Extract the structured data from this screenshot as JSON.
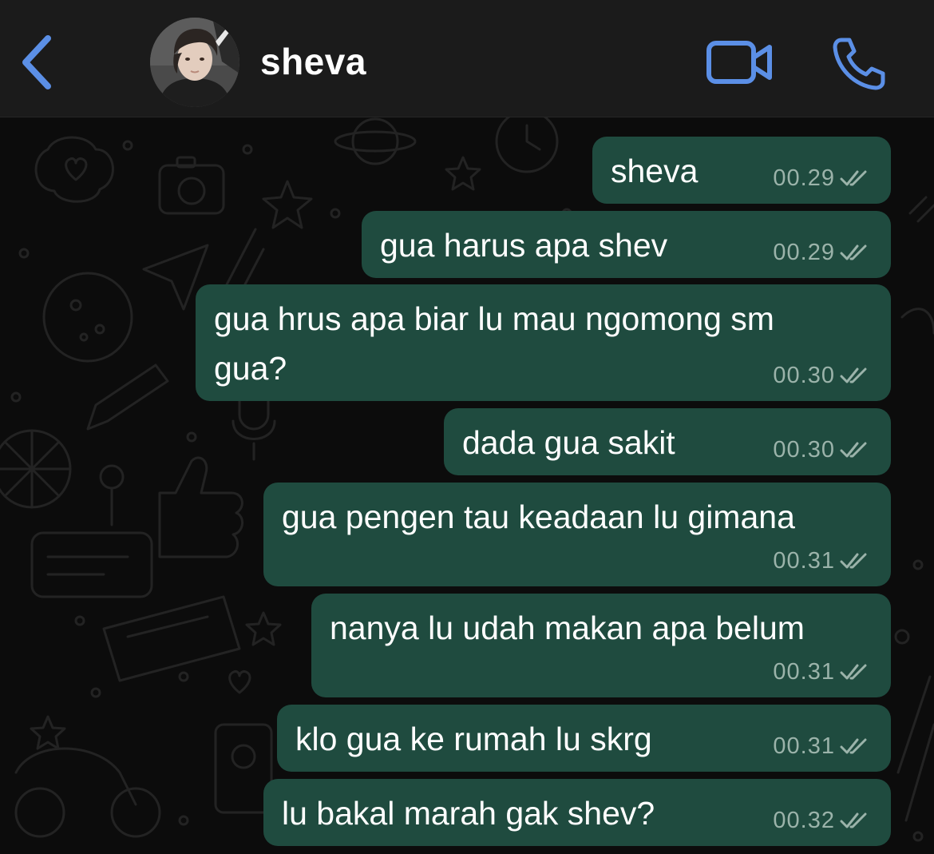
{
  "header": {
    "contact_name": "sheva",
    "back_icon": "chevron-left-icon",
    "video_icon": "video-camera-icon",
    "call_icon": "phone-icon",
    "accent_color": "#5b8fe6"
  },
  "chat": {
    "bubble_color": "#1f4b3f",
    "messages": [
      {
        "text": "sheva",
        "time": "00.29",
        "status": "read"
      },
      {
        "text": "gua harus apa shev",
        "time": "00.29",
        "status": "read"
      },
      {
        "text": "gua hrus apa biar lu mau ngomong sm",
        "text_line2": "gua?",
        "time": "00.30",
        "status": "read"
      },
      {
        "text": "dada gua sakit",
        "time": "00.30",
        "status": "read"
      },
      {
        "text": "gua pengen tau keadaan lu gimana",
        "time": "00.31",
        "status": "read"
      },
      {
        "text": "nanya lu udah makan apa belum",
        "time": "00.31",
        "status": "read"
      },
      {
        "text": "klo gua ke rumah lu skrg",
        "time": "00.31",
        "status": "read"
      },
      {
        "text": "lu bakal marah gak shev?",
        "time": "00.32",
        "status": "read"
      }
    ]
  }
}
